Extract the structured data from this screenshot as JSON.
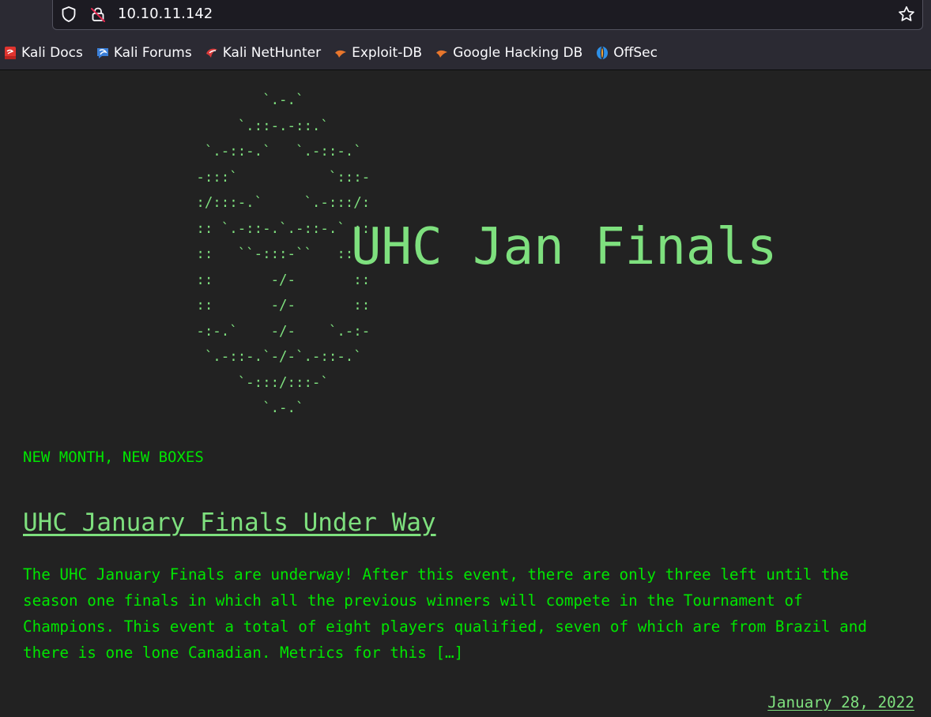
{
  "browser": {
    "url": "10.10.11.142",
    "bookmarks": [
      {
        "label": "Kali Docs",
        "icon": "kali-docs-icon",
        "color": "#e0342f"
      },
      {
        "label": "Kali Forums",
        "icon": "kali-forums-icon",
        "color": "#3b7fd8"
      },
      {
        "label": "Kali NetHunter",
        "icon": "kali-nethunter-icon",
        "color": "#d83a3a"
      },
      {
        "label": "Exploit-DB",
        "icon": "exploit-db-icon",
        "color": "#e8762c"
      },
      {
        "label": "Google Hacking DB",
        "icon": "google-hacking-db-icon",
        "color": "#e8762c"
      },
      {
        "label": "OffSec",
        "icon": "offsec-icon",
        "color": "#2e8fe6"
      }
    ]
  },
  "site": {
    "ascii_logo": "             `.-.`\n          `.::-.-::.`\n      `.-::-.`   `.-::-.`\n     -:::`           `:::-\n     :/:::-.`     `.-:::/:\n     :: `.-::-.`.-::-.` ::\n     ::   ``-:::-``   ::\n     ::       -/-       ::\n     ::       -/-       ::\n     -:-.`    -/-    `.-:-\n      `.-::-.`-/-`.-::-.`\n          `-:::/:::-`\n             `.-.`",
    "title": "UHC Jan Finals",
    "accent_color": "#7ee07e",
    "text_color": "#00e600",
    "background_color": "#222222"
  },
  "post": {
    "category": "NEW MONTH, NEW BOXES",
    "title": "UHC January Finals Under Way",
    "excerpt": "The UHC January Finals are underway! After this event, there are only three left until the\nseason one finals in which all the previous winners will compete in the Tournament of\nChampions. This event a total of eight players qualified, seven of which are from Brazil and\nthere is one lone Canadian. Metrics for this […]",
    "date": "January 28, 2022"
  }
}
